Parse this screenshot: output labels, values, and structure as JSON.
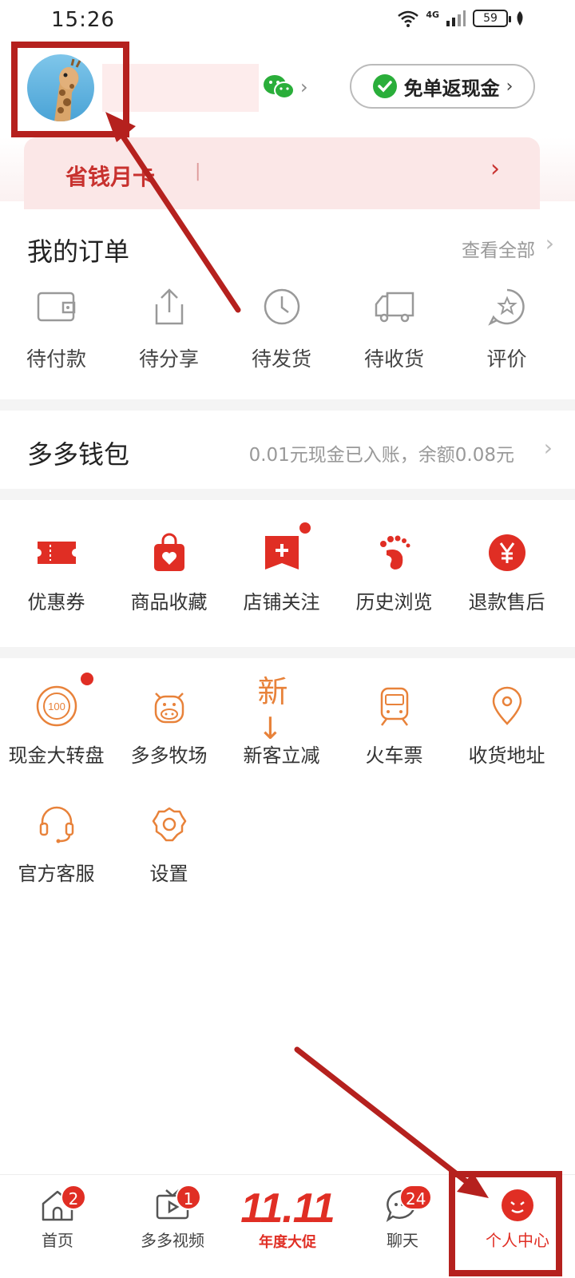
{
  "status_bar": {
    "time": "15:26",
    "network": "4G",
    "battery": "59"
  },
  "profile": {
    "cashback_button": "免单返现金",
    "monthly_card": "省钱月卡"
  },
  "orders": {
    "title": "我的订单",
    "view_all": "查看全部",
    "items": [
      {
        "label": "待付款",
        "icon": "wallet-icon"
      },
      {
        "label": "待分享",
        "icon": "share-icon"
      },
      {
        "label": "待发货",
        "icon": "clock-icon"
      },
      {
        "label": "待收货",
        "icon": "truck-icon"
      },
      {
        "label": "评价",
        "icon": "review-icon"
      }
    ]
  },
  "wallet": {
    "title": "多多钱包",
    "info": "0.01元现金已入账，余额0.08元"
  },
  "tools_primary": [
    {
      "label": "优惠券",
      "icon": "coupon-icon"
    },
    {
      "label": "商品收藏",
      "icon": "favorite-bag-icon"
    },
    {
      "label": "店铺关注",
      "icon": "store-follow-icon"
    },
    {
      "label": "历史浏览",
      "icon": "footprint-icon"
    },
    {
      "label": "退款售后",
      "icon": "refund-icon"
    }
  ],
  "tools_secondary": [
    {
      "label": "现金大转盘",
      "icon": "cash-wheel-icon"
    },
    {
      "label": "多多牧场",
      "icon": "cow-icon"
    },
    {
      "label": "新客立减",
      "icon": "new-customer-icon",
      "glyph": "新↓"
    },
    {
      "label": "火车票",
      "icon": "train-icon"
    },
    {
      "label": "收货地址",
      "icon": "location-icon"
    },
    {
      "label": "官方客服",
      "icon": "headset-icon"
    },
    {
      "label": "设置",
      "icon": "settings-icon"
    }
  ],
  "bottom_nav": {
    "home": {
      "label": "首页",
      "badge": "2"
    },
    "video": {
      "label": "多多视频",
      "badge": "1"
    },
    "promo": {
      "big": "11.11",
      "label": "年度大促"
    },
    "chat": {
      "label": "聊天",
      "badge": "24"
    },
    "profile": {
      "label": "个人中心"
    }
  },
  "colors": {
    "brand_red": "#e02e24",
    "annotation_red": "#b5211e",
    "icon_orange": "#e8823a"
  }
}
